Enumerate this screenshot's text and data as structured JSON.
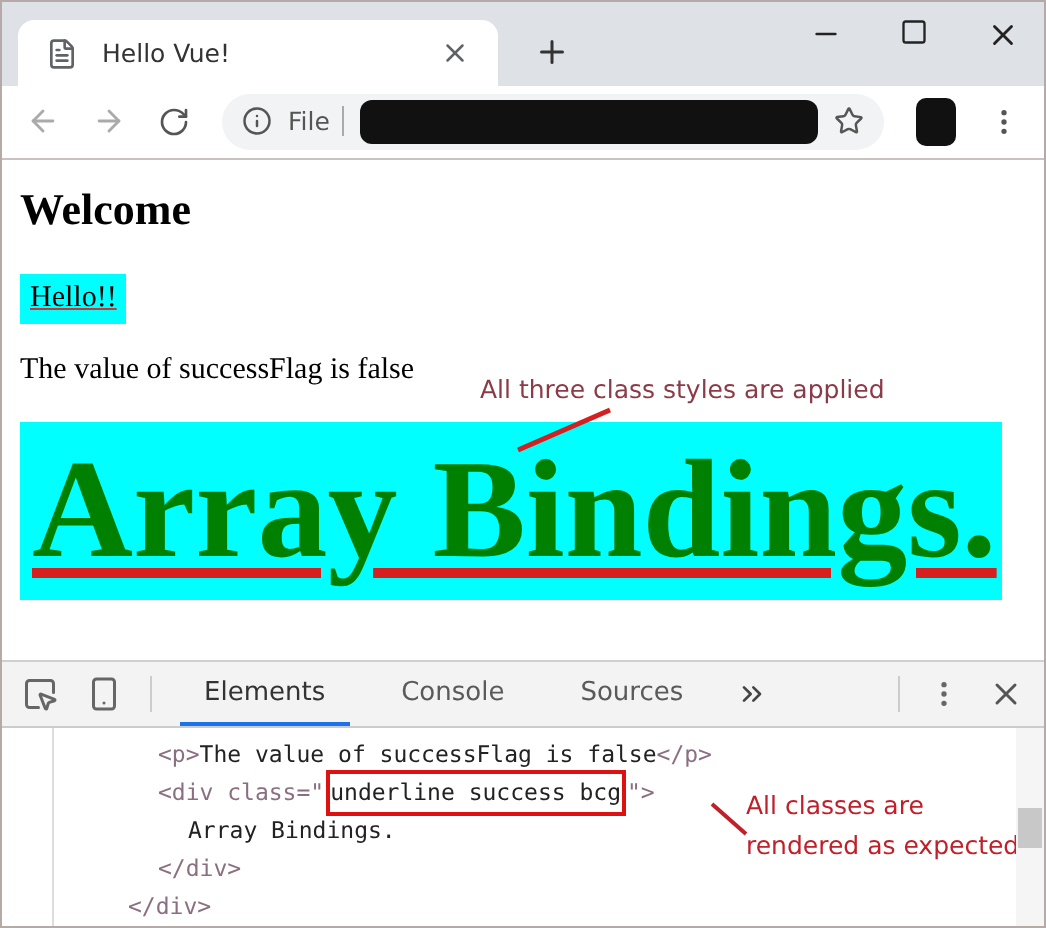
{
  "browser": {
    "tab_title": "Hello Vue!",
    "address_scheme": "File"
  },
  "page": {
    "heading": "Welcome",
    "hello": "Hello!!",
    "paragraph": "The value of successFlag is false",
    "banner": "Array Bindings.",
    "annotation": "All three class styles are applied"
  },
  "devtools": {
    "tabs": [
      {
        "label": "Elements",
        "selected": true
      },
      {
        "label": "Console",
        "selected": false
      },
      {
        "label": "Sources",
        "selected": false
      }
    ],
    "dom": {
      "children": [
        {
          "tokens": [
            {
              "kind": "tag",
              "text": "<p>"
            },
            {
              "kind": "text",
              "text": "The value of successFlag is false"
            },
            {
              "kind": "tag",
              "text": "</p>"
            }
          ]
        },
        {
          "tokens": [
            {
              "kind": "tag",
              "text": "<div class=\""
            },
            {
              "kind": "text",
              "text": "underline success bcg",
              "highlighted": true
            },
            {
              "kind": "tag",
              "text": "\">"
            }
          ],
          "children": [
            {
              "tokens": [
                {
                  "kind": "text",
                  "text": "Array Bindings."
                }
              ]
            }
          ],
          "close": [
            {
              "kind": "tag",
              "text": "</div>"
            }
          ]
        }
      ],
      "close": [
        {
          "kind": "tag",
          "text": "</div>"
        }
      ]
    },
    "annotation_lines": [
      "All classes are",
      "rendered as expected"
    ]
  }
}
